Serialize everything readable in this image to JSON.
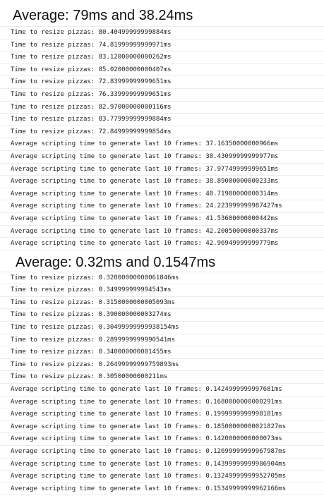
{
  "sections": [
    {
      "heading": "Average: 79ms and 38.24ms",
      "rows": [
        "Time to resize pizzas: 80.40499999999884ms",
        "Time to resize pizzas: 74.81999999999971ms",
        "Time to resize pizzas: 83.12000000000262ms",
        "Time to resize pizzas: 85.02000000000407ms",
        "Time to resize pizzas: 72.83999999999651ms",
        "Time to resize pizzas: 76.33999999999651ms",
        "Time to resize pizzas: 82.97000000000116ms",
        "Time to resize pizzas: 83.77999999999884ms",
        "Time to resize pizzas: 72.84999999999854ms",
        "Average scripting time to generate last 10 frames: 37.16350000000966ms",
        "Average scripting time to generate last 10 frames: 38.43099999999977ms",
        "Average scripting time to generate last 10 frames: 37.97749999999651ms",
        "Average scripting time to generate last 10 frames: 38.89000000000233ms",
        "Average scripting time to generate last 10 frames: 40.71900000000314ms",
        "Average scripting time to generate last 10 frames: 24.223999999987427ms",
        "Average scripting time to generate last 10 frames: 41.53600000000442ms",
        "Average scripting time to generate last 10 frames: 42.20050000000337ms",
        "Average scripting time to generate last 10 frames: 42.96949999999779ms"
      ]
    },
    {
      "heading": "Average: 0.32ms and 0.1547ms",
      "rows": [
        "Time to resize pizzas: 0.32000000000061846ms",
        "Time to resize pizzas: 0.349999999994543ms",
        "Time to resize pizzas: 0.3150000000005093ms",
        "Time to resize pizzas: 0.390000000003274ms",
        "Time to resize pizzas: 0.30499999999938154ms",
        "Time to resize pizzas: 0.2899999999990541ms",
        "Time to resize pizzas: 0.340000000001455ms",
        "Time to resize pizzas: 0.26499999999759893ms",
        "Time to resize pizzas: 0.30500000000211ms",
        "Average scripting time to generate last 10 frames: 0.1424999999997681ms",
        "Average scripting time to generate last 10 frames: 0.1680000000000291ms",
        "Average scripting time to generate last 10 frames: 0.1999999999998181ms",
        "Average scripting time to generate last 10 frames: 0.18500000000021827ms",
        "Average scripting time to generate last 10 frames: 0.1420000000000073ms",
        "Average scripting time to generate last 10 frames: 0.12699999999967987ms",
        "Average scripting time to generate last 10 frames: 0.14399999999986904ms",
        "Average scripting time to generate last 10 frames: 0.13249999999952705ms",
        "Average scripting time to generate last 10 frames: 0.15349999999962166ms"
      ]
    }
  ]
}
